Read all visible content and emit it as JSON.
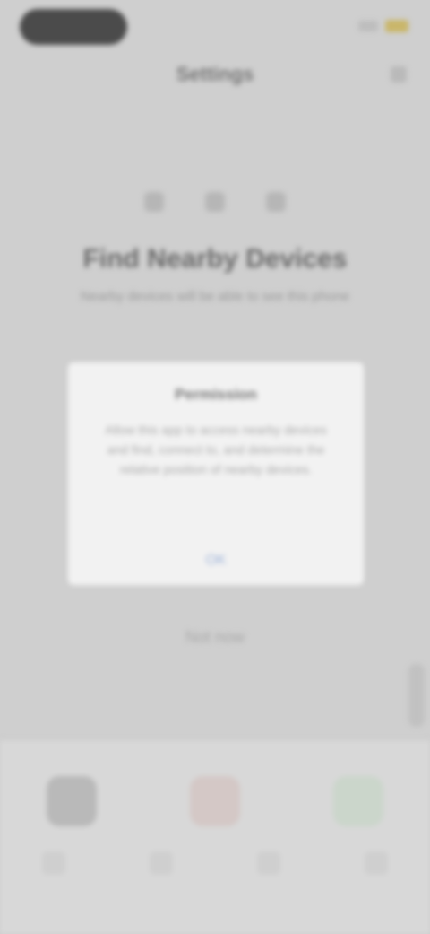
{
  "nav": {
    "title": "Settings"
  },
  "header": {
    "headline": "Find Nearby Devices",
    "subline": "Nearby devices will be able to see this phone"
  },
  "dialog": {
    "title": "Permission",
    "body": "Allow this app to access nearby devices and find, connect to, and determine the relative position of nearby devices.",
    "confirm_label": "OK"
  },
  "footer": {
    "link_label": "Not now"
  }
}
